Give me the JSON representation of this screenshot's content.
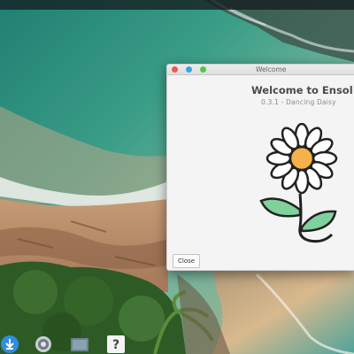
{
  "window": {
    "title": "Welcome",
    "heading": "Welcome to Ensol",
    "version": "0.3.1 - Dancing Daisy",
    "close_label": "Close"
  },
  "dock": {
    "items": [
      {
        "icon": "download-icon"
      },
      {
        "icon": "settings-icon"
      },
      {
        "icon": "files-icon"
      },
      {
        "icon": "help-icon",
        "glyph": "?"
      }
    ]
  },
  "colors": {
    "titlebar_close": "#ed5a4f",
    "titlebar_minimize": "#3aa4e3",
    "titlebar_maximize": "#52c64a",
    "daisy_center": "#f5b249",
    "leaf": "#7fd29b"
  }
}
